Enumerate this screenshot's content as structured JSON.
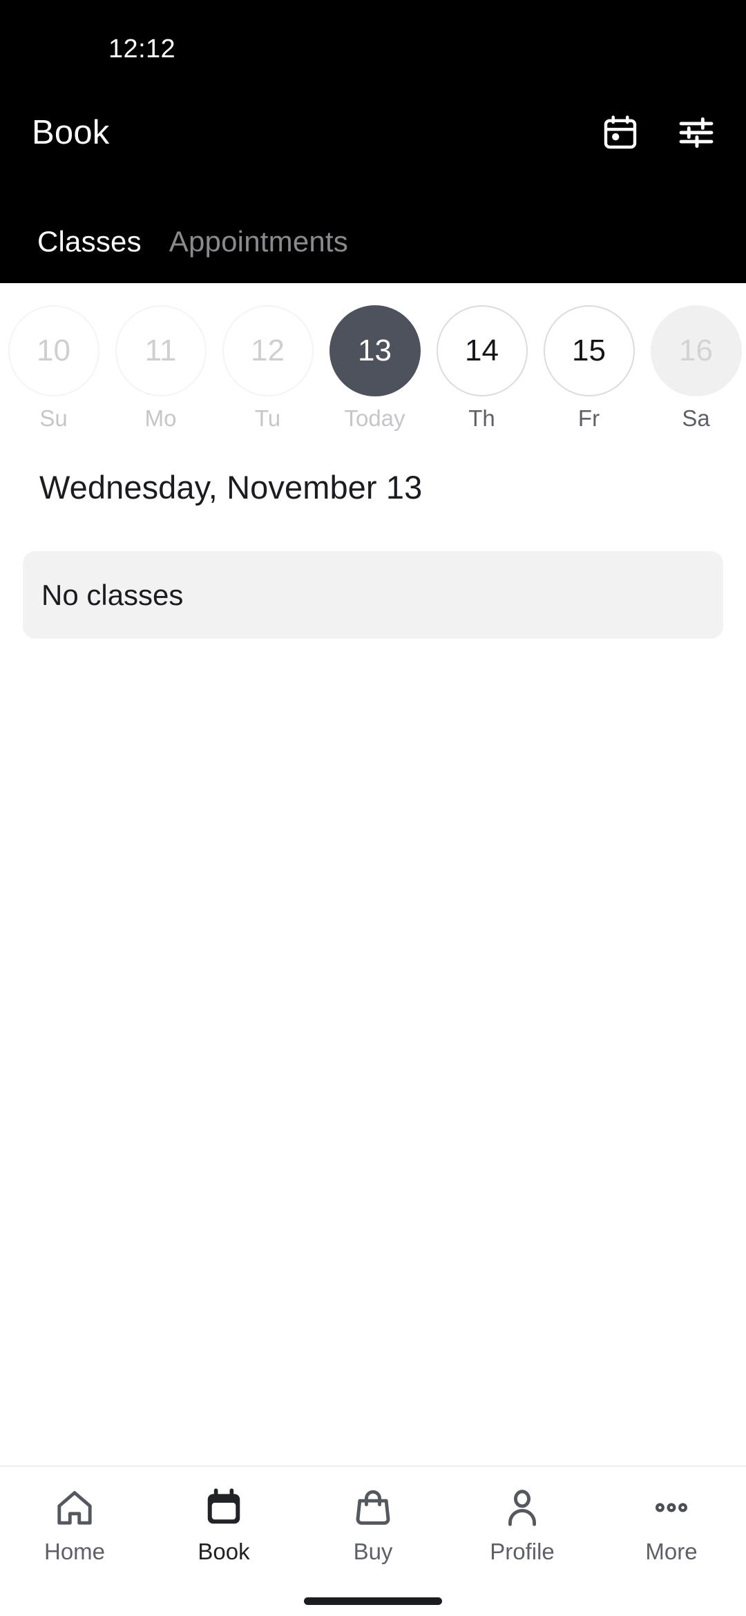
{
  "status_bar": {
    "time": "12:12"
  },
  "app_bar": {
    "title": "Book",
    "actions": [
      {
        "name": "calendar-icon",
        "label": "Calendar"
      },
      {
        "name": "filter-icon",
        "label": "Filters"
      }
    ]
  },
  "tabs": {
    "items": [
      {
        "label": "Classes",
        "active": true
      },
      {
        "label": "Appointments",
        "active": false
      }
    ]
  },
  "date_strip": {
    "days": [
      {
        "number": "10",
        "weekday": "Su",
        "state": "past"
      },
      {
        "number": "11",
        "weekday": "Mo",
        "state": "past"
      },
      {
        "number": "12",
        "weekday": "Tu",
        "state": "past"
      },
      {
        "number": "13",
        "weekday": "Today",
        "state": "selected"
      },
      {
        "number": "14",
        "weekday": "Th",
        "state": "future"
      },
      {
        "number": "15",
        "weekday": "Fr",
        "state": "future"
      },
      {
        "number": "16",
        "weekday": "Sa",
        "state": "disabled"
      }
    ]
  },
  "content": {
    "date_heading": "Wednesday, November 13",
    "empty_state": "No classes"
  },
  "bottom_nav": {
    "items": [
      {
        "label": "Home",
        "icon": "home-icon",
        "active": false
      },
      {
        "label": "Book",
        "icon": "calendar-icon",
        "active": true
      },
      {
        "label": "Buy",
        "icon": "bag-icon",
        "active": false
      },
      {
        "label": "Profile",
        "icon": "person-icon",
        "active": false
      },
      {
        "label": "More",
        "icon": "more-icon",
        "active": false
      }
    ]
  },
  "colors": {
    "header_bg": "#000000",
    "selected_day": "#4d525c",
    "card_bg": "#f2f2f3",
    "nav_icon": "#55595f",
    "nav_active": "#222326"
  }
}
